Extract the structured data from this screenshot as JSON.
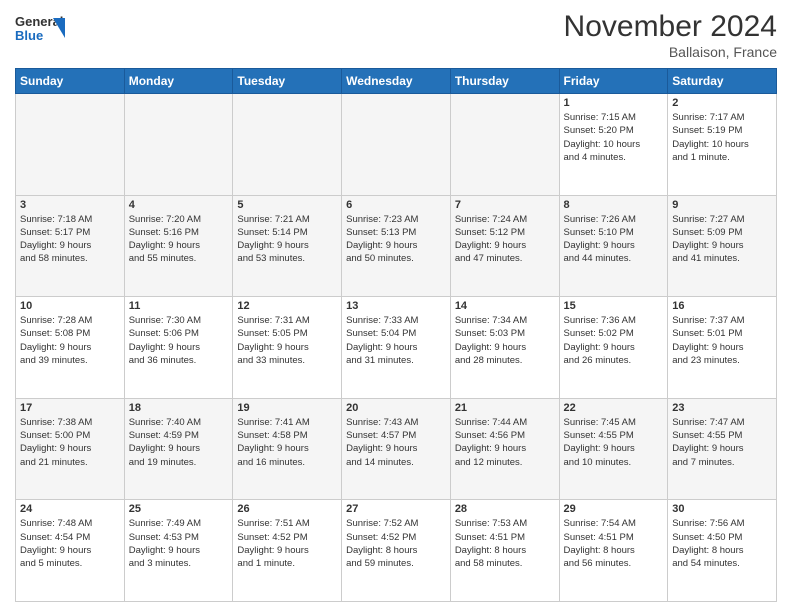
{
  "logo": {
    "general": "General",
    "blue": "Blue"
  },
  "header": {
    "month": "November 2024",
    "location": "Ballaison, France"
  },
  "days_of_week": [
    "Sunday",
    "Monday",
    "Tuesday",
    "Wednesday",
    "Thursday",
    "Friday",
    "Saturday"
  ],
  "weeks": [
    [
      {
        "day": "",
        "info": ""
      },
      {
        "day": "",
        "info": ""
      },
      {
        "day": "",
        "info": ""
      },
      {
        "day": "",
        "info": ""
      },
      {
        "day": "",
        "info": ""
      },
      {
        "day": "1",
        "info": "Sunrise: 7:15 AM\nSunset: 5:20 PM\nDaylight: 10 hours\nand 4 minutes."
      },
      {
        "day": "2",
        "info": "Sunrise: 7:17 AM\nSunset: 5:19 PM\nDaylight: 10 hours\nand 1 minute."
      }
    ],
    [
      {
        "day": "3",
        "info": "Sunrise: 7:18 AM\nSunset: 5:17 PM\nDaylight: 9 hours\nand 58 minutes."
      },
      {
        "day": "4",
        "info": "Sunrise: 7:20 AM\nSunset: 5:16 PM\nDaylight: 9 hours\nand 55 minutes."
      },
      {
        "day": "5",
        "info": "Sunrise: 7:21 AM\nSunset: 5:14 PM\nDaylight: 9 hours\nand 53 minutes."
      },
      {
        "day": "6",
        "info": "Sunrise: 7:23 AM\nSunset: 5:13 PM\nDaylight: 9 hours\nand 50 minutes."
      },
      {
        "day": "7",
        "info": "Sunrise: 7:24 AM\nSunset: 5:12 PM\nDaylight: 9 hours\nand 47 minutes."
      },
      {
        "day": "8",
        "info": "Sunrise: 7:26 AM\nSunset: 5:10 PM\nDaylight: 9 hours\nand 44 minutes."
      },
      {
        "day": "9",
        "info": "Sunrise: 7:27 AM\nSunset: 5:09 PM\nDaylight: 9 hours\nand 41 minutes."
      }
    ],
    [
      {
        "day": "10",
        "info": "Sunrise: 7:28 AM\nSunset: 5:08 PM\nDaylight: 9 hours\nand 39 minutes."
      },
      {
        "day": "11",
        "info": "Sunrise: 7:30 AM\nSunset: 5:06 PM\nDaylight: 9 hours\nand 36 minutes."
      },
      {
        "day": "12",
        "info": "Sunrise: 7:31 AM\nSunset: 5:05 PM\nDaylight: 9 hours\nand 33 minutes."
      },
      {
        "day": "13",
        "info": "Sunrise: 7:33 AM\nSunset: 5:04 PM\nDaylight: 9 hours\nand 31 minutes."
      },
      {
        "day": "14",
        "info": "Sunrise: 7:34 AM\nSunset: 5:03 PM\nDaylight: 9 hours\nand 28 minutes."
      },
      {
        "day": "15",
        "info": "Sunrise: 7:36 AM\nSunset: 5:02 PM\nDaylight: 9 hours\nand 26 minutes."
      },
      {
        "day": "16",
        "info": "Sunrise: 7:37 AM\nSunset: 5:01 PM\nDaylight: 9 hours\nand 23 minutes."
      }
    ],
    [
      {
        "day": "17",
        "info": "Sunrise: 7:38 AM\nSunset: 5:00 PM\nDaylight: 9 hours\nand 21 minutes."
      },
      {
        "day": "18",
        "info": "Sunrise: 7:40 AM\nSunset: 4:59 PM\nDaylight: 9 hours\nand 19 minutes."
      },
      {
        "day": "19",
        "info": "Sunrise: 7:41 AM\nSunset: 4:58 PM\nDaylight: 9 hours\nand 16 minutes."
      },
      {
        "day": "20",
        "info": "Sunrise: 7:43 AM\nSunset: 4:57 PM\nDaylight: 9 hours\nand 14 minutes."
      },
      {
        "day": "21",
        "info": "Sunrise: 7:44 AM\nSunset: 4:56 PM\nDaylight: 9 hours\nand 12 minutes."
      },
      {
        "day": "22",
        "info": "Sunrise: 7:45 AM\nSunset: 4:55 PM\nDaylight: 9 hours\nand 10 minutes."
      },
      {
        "day": "23",
        "info": "Sunrise: 7:47 AM\nSunset: 4:55 PM\nDaylight: 9 hours\nand 7 minutes."
      }
    ],
    [
      {
        "day": "24",
        "info": "Sunrise: 7:48 AM\nSunset: 4:54 PM\nDaylight: 9 hours\nand 5 minutes."
      },
      {
        "day": "25",
        "info": "Sunrise: 7:49 AM\nSunset: 4:53 PM\nDaylight: 9 hours\nand 3 minutes."
      },
      {
        "day": "26",
        "info": "Sunrise: 7:51 AM\nSunset: 4:52 PM\nDaylight: 9 hours\nand 1 minute."
      },
      {
        "day": "27",
        "info": "Sunrise: 7:52 AM\nSunset: 4:52 PM\nDaylight: 8 hours\nand 59 minutes."
      },
      {
        "day": "28",
        "info": "Sunrise: 7:53 AM\nSunset: 4:51 PM\nDaylight: 8 hours\nand 58 minutes."
      },
      {
        "day": "29",
        "info": "Sunrise: 7:54 AM\nSunset: 4:51 PM\nDaylight: 8 hours\nand 56 minutes."
      },
      {
        "day": "30",
        "info": "Sunrise: 7:56 AM\nSunset: 4:50 PM\nDaylight: 8 hours\nand 54 minutes."
      }
    ]
  ]
}
